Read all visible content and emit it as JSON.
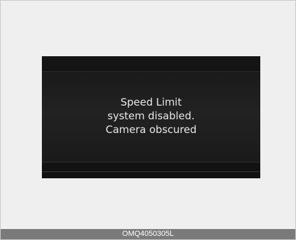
{
  "display": {
    "message_lines": [
      "Speed Limit",
      "system disabled.",
      "Camera obscured"
    ]
  },
  "caption": {
    "code": "OMQ4050305L"
  },
  "colors": {
    "page_background": "#efefef",
    "display_background": "#1b1b1b",
    "message_text": "#e8e8e8",
    "caption_bar": "#7a7a7a"
  }
}
